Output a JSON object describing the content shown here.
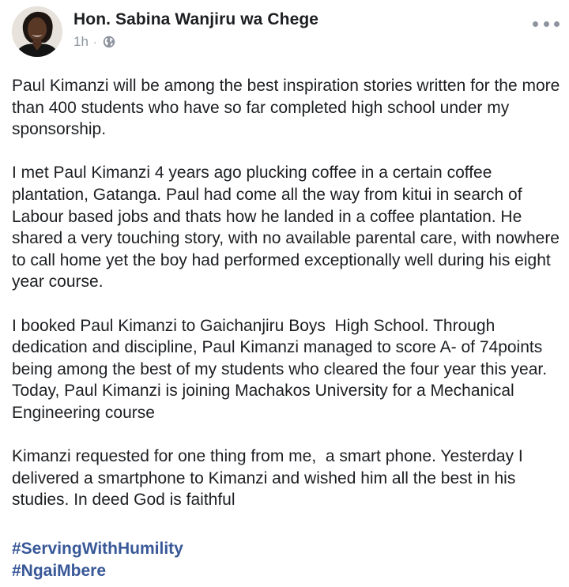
{
  "post": {
    "author": "Hon. Sabina Wanjiru wa Chege",
    "time": "1h",
    "separator": "·",
    "audience_icon": "globe-icon",
    "more_icon": "more-horizontal-icon",
    "avatar": "profile-photo",
    "paragraphs": [
      "Paul Kimanzi will be among the best inspiration stories written for the more than 400 students who have so far completed high school under my sponsorship.",
      "I met Paul Kimanzi 4 years ago plucking coffee in a certain coffee plantation, Gatanga. Paul had come all the way from kitui in search of Labour based jobs and thats how he landed in a coffee plantation. He shared a very touching story, with no available parental care, with nowhere to call home yet the boy had performed exceptionally well during his eight year course.",
      "I booked Paul Kimanzi to Gaichanjiru Boys  High School. Through dedication and discipline, Paul Kimanzi managed to score A- of 74points being among the best of my students who cleared the four year this year. Today, Paul Kimanzi is joining Machakos University for a Mechanical Engineering course",
      "Kimanzi requested for one thing from me,  a smart phone. Yesterday I delivered a smartphone to Kimanzi and wished him all the best in his studies. In deed God is faithful"
    ],
    "hashtags": [
      "#ServingWithHumility",
      "#NgaiMbere"
    ]
  },
  "colors": {
    "text": "#1c1e21",
    "meta": "#8d949e",
    "hashtag": "#385898",
    "background": "#ffffff"
  }
}
